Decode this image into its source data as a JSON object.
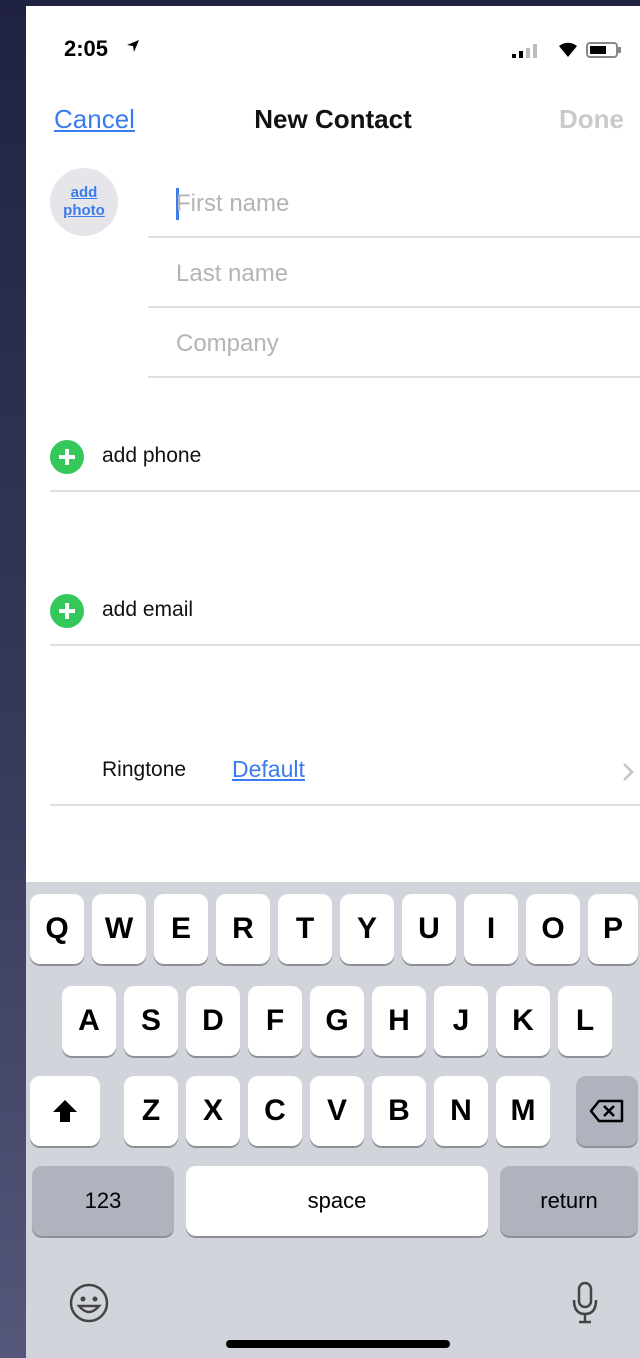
{
  "status_bar": {
    "time": "2:05"
  },
  "nav": {
    "cancel": "Cancel",
    "title": "New Contact",
    "done": "Done"
  },
  "avatar": {
    "line1": "add",
    "line2": "photo"
  },
  "fields": {
    "first_name_placeholder": "First name",
    "last_name_placeholder": "Last name",
    "company_placeholder": "Company"
  },
  "rows": {
    "add_phone": "add phone",
    "add_email": "add email",
    "ringtone_label": "Ringtone",
    "ringtone_value": "Default"
  },
  "keyboard": {
    "row1": [
      "Q",
      "W",
      "E",
      "R",
      "T",
      "Y",
      "U",
      "I",
      "O",
      "P"
    ],
    "row2": [
      "A",
      "S",
      "D",
      "F",
      "G",
      "H",
      "J",
      "K",
      "L"
    ],
    "row3": [
      "Z",
      "X",
      "C",
      "V",
      "B",
      "N",
      "M"
    ],
    "numbers": "123",
    "space": "space",
    "return": "return"
  },
  "colors": {
    "accent": "#3a7bf0",
    "add_green": "#34c759"
  }
}
